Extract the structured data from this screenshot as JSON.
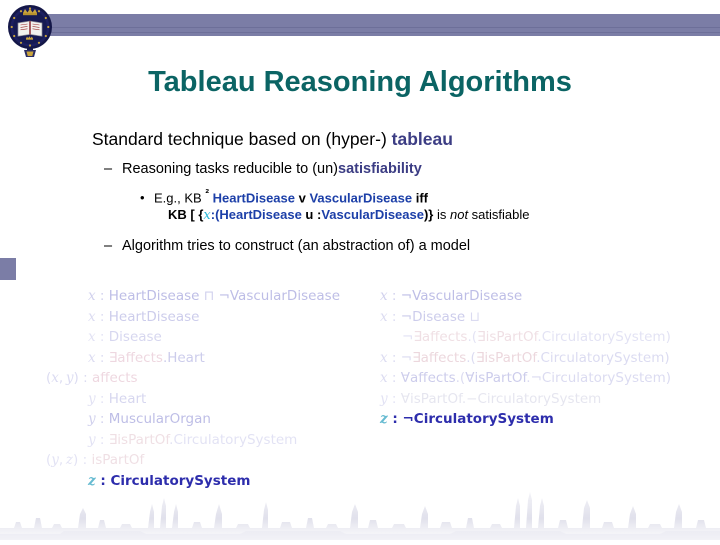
{
  "slide": {
    "title": "Tableau Reasoning Algorithms",
    "accent_color": "#0b6464",
    "banner_color": "#7b7da6"
  },
  "outline": {
    "level1": {
      "text_before": "Standard technique based on (hyper-) ",
      "highlight": "tableau",
      "highlight_color": "#3c3d84"
    },
    "level2_a": {
      "dash": "–",
      "text_before": "Reasoning tasks reducible to (un)",
      "highlight": "satisfiability",
      "highlight_color": "#3c3d84"
    },
    "level3": {
      "bullet": "•",
      "line1": {
        "p1": "E.g., KB ",
        "entails": "²",
        "p2": " ",
        "concept1": "HeartDisease",
        "op": " v ",
        "concept2": "VascularDisease",
        "p3": " iff"
      },
      "line2": {
        "p1": "KB ",
        "sub": "[",
        "p2": " {",
        "variable": "x",
        "p3": ":(",
        "concept1": "HeartDisease",
        "op": " u ",
        "colon": ":",
        "concept2": "VascularDisease",
        "p4": ")}",
        "p5": " is ",
        "italic": "not",
        "p6": " satisfiable"
      }
    },
    "level2_b": {
      "dash": "–",
      "text": "Algorithm tries to construct (an abstraction of) a model"
    }
  },
  "math": {
    "left_column": [
      "x : HeartDisease ⊓ ¬VascularDisease",
      "x : HeartDisease",
      "x : Disease",
      "x : ∃affects.Heart",
      "(x, y) : affects",
      "y : Heart",
      "y : MuscularOrgan",
      "y : ∃isPartOf.CirculatorySystem",
      "(y, z) : isPartOf",
      "z : CirculatorySystem"
    ],
    "right_column": [
      "x : ¬VascularDisease",
      "x : ¬Disease ⊔",
      "¬∃affects.(∃isPartOf.CirculatorySystem)",
      "x : ¬∃affects.(∃isPartOf.CirculatorySystem)",
      "x : ∀affects.(∀isPartOf.¬CirculatorySystem)",
      "y : ∀isPartOf.¬CirculatorySystem",
      "z : ¬CirculatorySystem"
    ]
  },
  "decor": {
    "crest_name": "oxford-university-crest",
    "skyline_name": "oxford-skyline-silhouette"
  }
}
